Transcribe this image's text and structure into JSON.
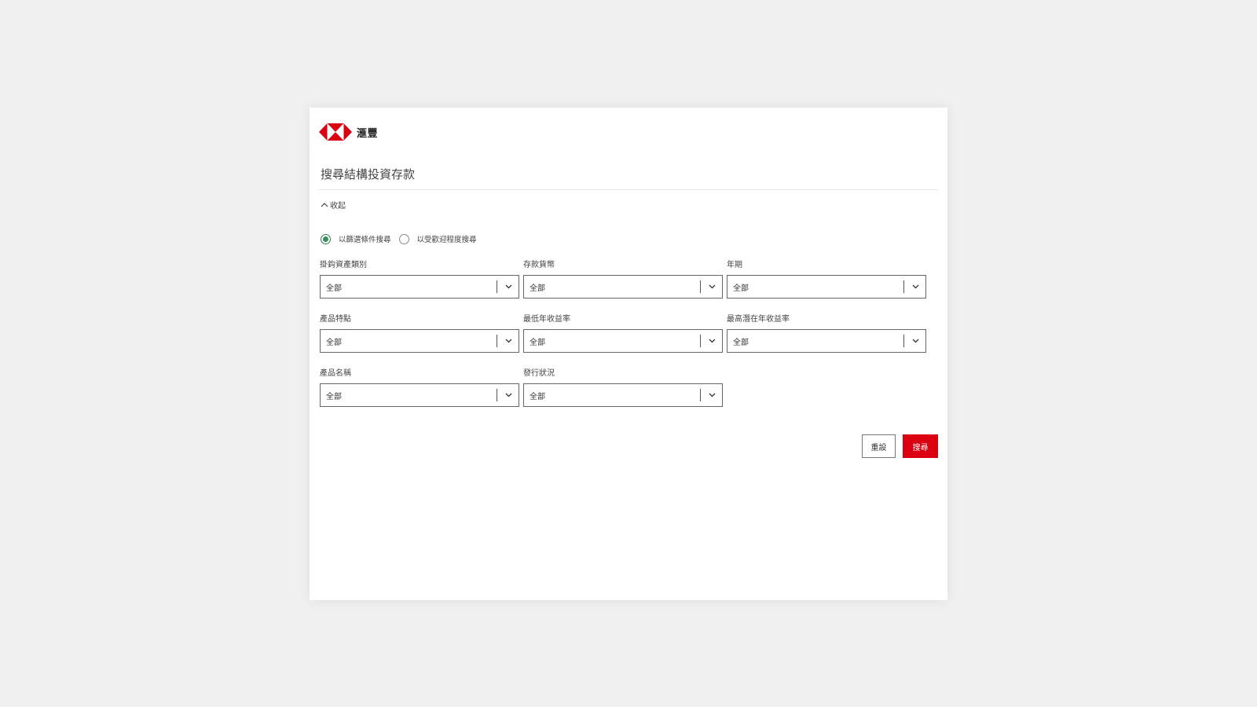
{
  "brand": {
    "logo_text": "滙豐",
    "logo_color": "#db0011"
  },
  "page_title": "搜尋結構投資存款",
  "collapse_label": "收起",
  "search_mode": {
    "options": [
      {
        "label": "以篩選條件搜尋",
        "checked": true
      },
      {
        "label": "以受歡迎程度搜尋",
        "checked": false
      }
    ],
    "checked_color": "#3a8e5c"
  },
  "filters": [
    {
      "label": "掛鈎資產類別",
      "value": "全部"
    },
    {
      "label": "存款貨幣",
      "value": "全部"
    },
    {
      "label": "年期",
      "value": "全部"
    },
    {
      "label": "產品特點",
      "value": "全部"
    },
    {
      "label": "最低年收益率",
      "value": "全部"
    },
    {
      "label": "最高潛在年收益率",
      "value": "全部"
    },
    {
      "label": "產品名稱",
      "value": "全部"
    },
    {
      "label": "發行狀況",
      "value": "全部"
    }
  ],
  "buttons": {
    "reset_label": "重設",
    "search_label": "搜尋",
    "search_color": "#db0011"
  }
}
